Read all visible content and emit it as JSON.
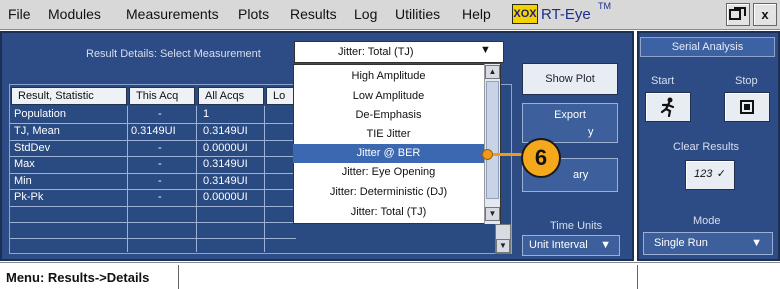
{
  "menubar": {
    "items": [
      "File",
      "Modules",
      "Measurements",
      "Plots",
      "Results",
      "Log",
      "Utilities",
      "Help"
    ],
    "logo_mark": "XOX",
    "app_name": "RT-Eye",
    "app_tm": "TM",
    "window_buttons": [
      "restore-icon",
      "close-icon"
    ],
    "close_label": "x"
  },
  "result_details": {
    "label": "Result Details: Select Measurement",
    "selected": "Jitter: Total (TJ)"
  },
  "table": {
    "headers": [
      "Result, Statistic",
      "This Acq",
      "All Acqs",
      "Lo"
    ],
    "rows": [
      [
        "Population",
        "-",
        "1"
      ],
      [
        "TJ, Mean",
        "0.3149UI",
        "0.3149UI"
      ],
      [
        "StdDev",
        "-",
        "0.0000UI"
      ],
      [
        "Max",
        "-",
        "0.3149UI"
      ],
      [
        "Min",
        "-",
        "0.3149UI"
      ],
      [
        "Pk-Pk",
        "-",
        "0.0000UI"
      ]
    ]
  },
  "dropdown": {
    "options": [
      "High Amplitude",
      "Low Amplitude",
      "De-Emphasis",
      "TIE Jitter",
      "Jitter @ BER",
      "Jitter: Eye Opening",
      "Jitter: Deterministic (DJ)",
      "Jitter: Total (TJ)"
    ],
    "highlighted": "Jitter @ BER"
  },
  "controls": {
    "show_plot": "Show Plot",
    "export": "Export",
    "export_partial": "y",
    "summary_partial": "ary",
    "time_units_label": "Time Units",
    "time_units_value": "Unit Interval"
  },
  "serial": {
    "title": "Serial Analysis",
    "start_label": "Start",
    "stop_label": "Stop",
    "clear_label": "Clear Results",
    "clear_icon_text": "123",
    "mode_label": "Mode",
    "mode_value": "Single Run"
  },
  "callout": {
    "number": "6"
  },
  "status": {
    "text": "Menu: Results->Details"
  },
  "colors": {
    "panel": "#2d4c86",
    "highlight": "#3c67b1",
    "callout": "#f6a81c"
  }
}
